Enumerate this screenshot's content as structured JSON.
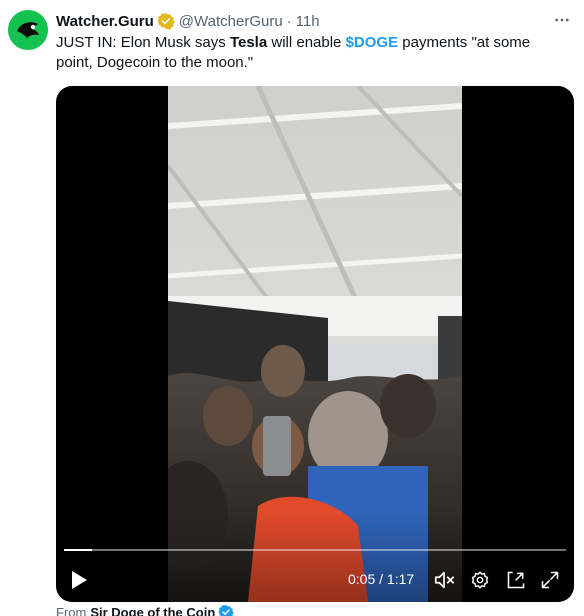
{
  "author": {
    "name": "Watcher.Guru",
    "handle": "@WatcherGuru",
    "separator": "·",
    "time": "11h",
    "avatar_icon": "watcher-guru-logo-icon",
    "verified_icon": "gold-verified-badge-icon"
  },
  "tweet": {
    "part1": "JUST IN: Elon Musk says ",
    "bold": "Tesla",
    "part2": " will enable ",
    "cashtag": "$DOGE",
    "part3": " payments \"at some point, Dogecoin to the moon.\""
  },
  "more_icon": "more-options-icon",
  "video": {
    "progress_fraction": 0.055,
    "timecode": "0:05 / 1:17",
    "play_icon": "play-icon",
    "mute_icon": "muted-speaker-icon",
    "settings_icon": "settings-gear-icon",
    "dock_icon": "dock-video-icon",
    "fullscreen_icon": "fullscreen-icon"
  },
  "attribution": {
    "prefix": "From",
    "name": "Sir Doge of the Coin",
    "verified_icon": "blue-verified-badge-icon"
  },
  "colors": {
    "link": "#1d9bf0",
    "secondary_text": "#536471",
    "avatar_bg": "#14c251",
    "gold_badge": "#e2b719"
  }
}
